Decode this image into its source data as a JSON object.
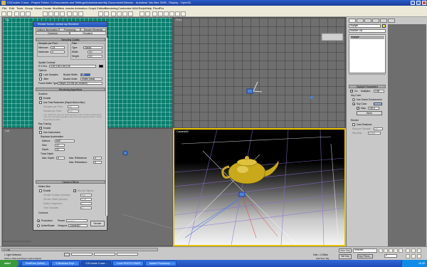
{
  "window": {
    "title": "CGCookie 2.max - Project Folder: C:\\Documents and Settings\\Administrator\\My Documents\\3dsmax - Autodesk 3ds Max 2008 - Display : OpenGL"
  },
  "menu": [
    "File",
    "Edit",
    "Tools",
    "Group",
    "Views",
    "Create",
    "Modifiers",
    "reactor",
    "Animation",
    "Graph Editors",
    "Rendering",
    "Customize",
    "MAXScript",
    "Help",
    "PivotPro"
  ],
  "viewports": {
    "top": "Top",
    "front": "Front",
    "left": "Left",
    "camera": "Camera02"
  },
  "dialog": {
    "title": "Render Scene: mental ray Renderer",
    "tabs_row1": [
      "Indirect Illumination",
      "Processing",
      "Render Elements"
    ],
    "tabs_row2": [
      "Common",
      "Renderer"
    ],
    "sampling": {
      "header": "Sampling Quality",
      "samples_per_pixel": "Samples per Pixel",
      "filter": "Filter",
      "minimum": "Minimum:",
      "minimum_val": "1/4",
      "maximum": "Maximum:",
      "maximum_val": "4",
      "type": "Type:",
      "type_val": "Gauss",
      "width": "Width:",
      "width_val": "3.0",
      "height": "Height:",
      "height_val": "3.0",
      "spatial_contrast": "Spatial Contrast",
      "rgba": "R G B A",
      "rgba_val": "0.05   0.05   0.05   0.05",
      "options": "Options",
      "lock_samples": "Lock Samples",
      "jitter": "Jitter",
      "bucket_width": "Bucket Width:",
      "bucket_width_val": "48",
      "bucket_order": "Bucket Order:",
      "bucket_order_val": "Hilbert (best)",
      "frame_buffer": "Frame Buffer Type:",
      "frame_buffer_val": "Integer (16 bits per channel)"
    },
    "rendering_algorithms": {
      "header": "Rendering Algorithms",
      "scanline": "Scanline",
      "enable": "Enable",
      "use_fast": "Use Fast Rasterizer (Rapid Motion Blur)",
      "samples_per_pixel": "Samples per Pixel:",
      "samples_val": "16",
      "shades_per_pixel": "Shades per Pixel:",
      "shades_val": "1.0",
      "note": "The rasterizer ignores pixel samples and contrast parameters from the Sampling Quality rollout and are ignored when using Rapid Motion Blur",
      "ray_tracing": "Ray Tracing",
      "rt_enable": "Enable",
      "use_autovolume": "Use Autovolume",
      "raytrace_accel": "Raytrace Acceleration",
      "method": "Method:",
      "method_val": "BSP",
      "size": "Size:",
      "size_val": "10",
      "depth": "Depth:",
      "depth_val": "40",
      "trace_depth": "Trace Depth",
      "max_depth": "Max. Depth:",
      "max_depth_val": "6",
      "max_reflections": "Max. Reflections:",
      "max_reflections_val": "4",
      "max_refractions": "Max. Refractions:",
      "max_refractions_val": "6"
    },
    "camera_effects": {
      "header": "Camera Effects",
      "motion_blur": "Motion Blur",
      "enable": "Enable",
      "blur_all": "Blur All Objects",
      "shutter_duration": "Shutter Duration (frames):",
      "shutter_duration_val": "0.5",
      "shutter_offset": "Shutter Offset (frames):",
      "shutter_offset_val": "0.25",
      "motion_segments": "Motion Segments:",
      "motion_segments_val": "1",
      "time_samples": "Time Samples:",
      "time_samples_val": "5",
      "contours": "Contours"
    },
    "footer": {
      "production": "Production",
      "activeshade": "ActiveShade",
      "preset": "Preset:",
      "preset_val": "----------",
      "viewport": "Viewport:",
      "viewport_val": "Camera02",
      "render": "Render"
    }
  },
  "command_panel": {
    "object_name": "Skylight",
    "modifier_list": "Modifier List",
    "stack_item": "Skylight",
    "params_header": "Skylight Parameters",
    "on": "On",
    "multiplier": "Multiplier:",
    "multiplier_val": "0.55",
    "sky_color": "Sky Color",
    "use_scene_env": "Use Scene Environment",
    "sky_color_opt": "Sky Color",
    "map": "Map:",
    "map_val": "100.0",
    "none": "None",
    "render": "Render",
    "cast_shadows": "Cast Shadows",
    "rays_per_sample": "Rays per Sample:",
    "rays_val": "20",
    "ray_bias": "Ray Bias:",
    "ray_bias_val": "0.005"
  },
  "status": {
    "lights_selected": "1 Light Selected",
    "prompt": "Click or click-and-drag to select objects",
    "timeline": "0 / 100",
    "grid": "Grid = 0.254m",
    "auto_key": "Auto Key",
    "selected": "Selected",
    "set_key": "Set Key",
    "key_filters": "Key Filters...",
    "add_time_tag": "Add Time Tag",
    "frame": "0"
  },
  "taskbar": {
    "start": "start",
    "items": [
      "RealFlow (Wind) - ...",
      "3 Windows Expl...",
      "CGCookie 2.max ...",
      "Corel PHOTO-PAINT ...",
      "Adobe Photoshop - ..."
    ],
    "time": "15:36"
  },
  "colors": {
    "teapot": "#c9a91a",
    "teal_grid": "#0a7e6e",
    "selection": "#2a5bc9"
  }
}
